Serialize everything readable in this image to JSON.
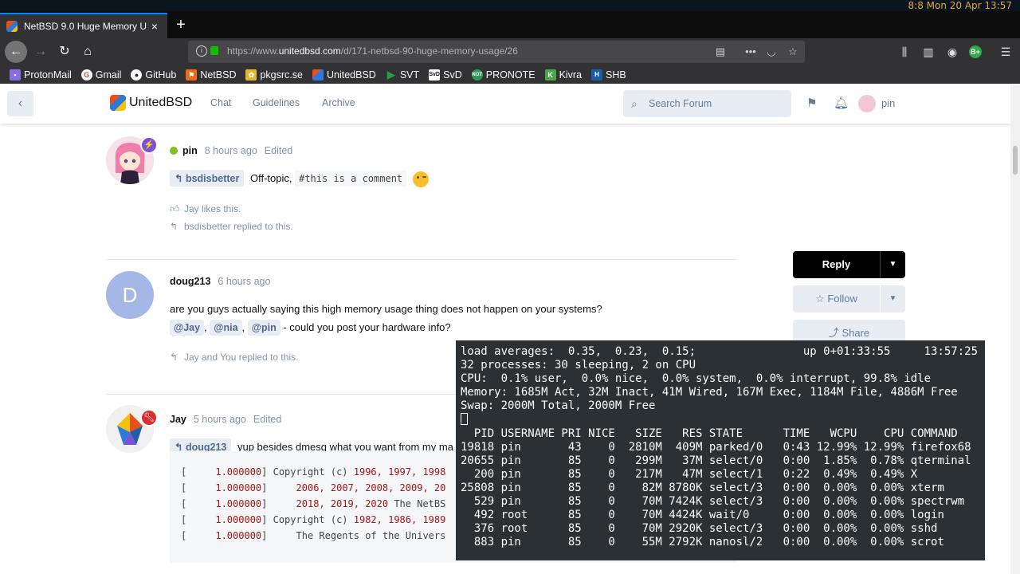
{
  "system": {
    "clock": "8:8  Mon 20 Apr  13:57"
  },
  "browser": {
    "tab_title": "NetBSD 9.0 Huge Memory U",
    "new_tab": "+",
    "close": "×",
    "url_prefix": "https://www.",
    "url_host": "unitedbsd.com",
    "url_path": "/d/171-netbsd-90-huge-memory-usage/26",
    "extension_badge": "B+"
  },
  "bookmarks": [
    {
      "label": "ProtonMail",
      "icon": "lock-icon",
      "color": "#8a6ee0"
    },
    {
      "label": "Gmail",
      "icon": "google-icon",
      "color": "#db4437"
    },
    {
      "label": "GitHub",
      "icon": "github-icon",
      "color": "#ffffff"
    },
    {
      "label": "NetBSD",
      "icon": "netbsd-flag-icon",
      "color": "#f26711"
    },
    {
      "label": "pkgsrc.se",
      "icon": "pkgsrc-icon",
      "color": "#e8b52b"
    },
    {
      "label": "UnitedBSD",
      "icon": "unitedbsd-icon",
      "color": "#2a7bd9"
    },
    {
      "label": "SVT",
      "icon": "play-icon",
      "color": "#1ea03c"
    },
    {
      "label": "SvD",
      "icon": "svd-icon",
      "color": "#ffffff"
    },
    {
      "label": "PRONOTE",
      "icon": "pronote-icon",
      "color": "#2e9a5a"
    },
    {
      "label": "Kivra",
      "icon": "kivra-icon",
      "color": "#4aa54a"
    },
    {
      "label": "SHB",
      "icon": "shb-icon",
      "color": "#1a5fa5"
    }
  ],
  "forum": {
    "brand": "UnitedBSD",
    "nav": [
      "Chat",
      "Guidelines",
      "Archive"
    ],
    "search_placeholder": "Search Forum",
    "user": "pin"
  },
  "posts": [
    {
      "username": "pin",
      "time": "8 hours ago",
      "edited": "Edited",
      "reply_to": "bsdisbetter",
      "text": "Off-topic,",
      "code": "#this is a comment",
      "likes": "Jay likes this.",
      "replies": "bsdisbetter replied to this."
    },
    {
      "username": "doug213",
      "avatar_letter": "D",
      "time": "6 hours ago",
      "line1": "are you guys actually saying this high memory usage thing does not happen on your systems?",
      "mentions": [
        "@Jay",
        "@nia",
        "@pin"
      ],
      "sep1": ",",
      "sep2": ",",
      "line2_tail": "- could you post your hardware info?",
      "replies": "Jay and You replied to this."
    },
    {
      "username": "Jay",
      "time": "5 hours ago",
      "edited": "Edited",
      "reply_to": "doug213",
      "text": "yup besides dmesg what you want from my ma",
      "code_lines": [
        {
          "a": "[     ",
          "n": "1.000000",
          "b": "] Copyright (c) ",
          "y": "1996, 1997, 1998"
        },
        {
          "a": "[     ",
          "n": "1.000000",
          "b": "]     ",
          "y": "2006, 2007, 2008, 2009, 20"
        },
        {
          "a": "[     ",
          "n": "1.000000",
          "b": "]     ",
          "y": "2018, 2019, 2020",
          "c": " The NetBS"
        },
        {
          "a": "[     ",
          "n": "1.000000",
          "b": "] Copyright (c) ",
          "y": "1982, 1986, 1989"
        },
        {
          "a": "[     ",
          "n": "1.000000",
          "b": "]     The Regents of the Univers"
        }
      ]
    }
  ],
  "sidebar": {
    "reply": "Reply",
    "follow": "Follow",
    "share": "Share"
  },
  "terminal": {
    "lines": [
      "load averages:  0.35,  0.23,  0.15;                up 0+01:33:55     13:57:25",
      "32 processes: 30 sleeping, 2 on CPU",
      "CPU:  0.1% user,  0.0% nice,  0.0% system,  0.0% interrupt, 99.8% idle",
      "Memory: 1685M Act, 32M Inact, 41M Wired, 167M Exec, 1184M File, 4886M Free",
      "Swap: 2000M Total, 2000M Free"
    ],
    "header": "  PID USERNAME PRI NICE   SIZE   RES STATE      TIME   WCPU    CPU COMMAND",
    "processes": [
      "19818 pin       43    0  2810M  409M parked/0   0:43 12.99% 12.99% firefox68",
      "20655 pin       85    0   299M   37M select/0   0:00  1.85%  0.78% qterminal",
      "  200 pin       85    0   217M   47M select/1   0:22  0.49%  0.49% X",
      "25808 pin       85    0    82M 8780K select/3   0:00  0.00%  0.00% xterm",
      "  529 pin       85    0    70M 7424K select/3   0:00  0.00%  0.00% spectrwm",
      "  492 root      85    0    70M 4424K wait/0     0:00  0.00%  0.00% login",
      "  376 root      85    0    70M 2920K select/3   0:00  0.00%  0.00% sshd",
      "  883 pin       85    0    55M 2792K nanosl/2   0:00  0.00%  0.00% scrot"
    ]
  }
}
